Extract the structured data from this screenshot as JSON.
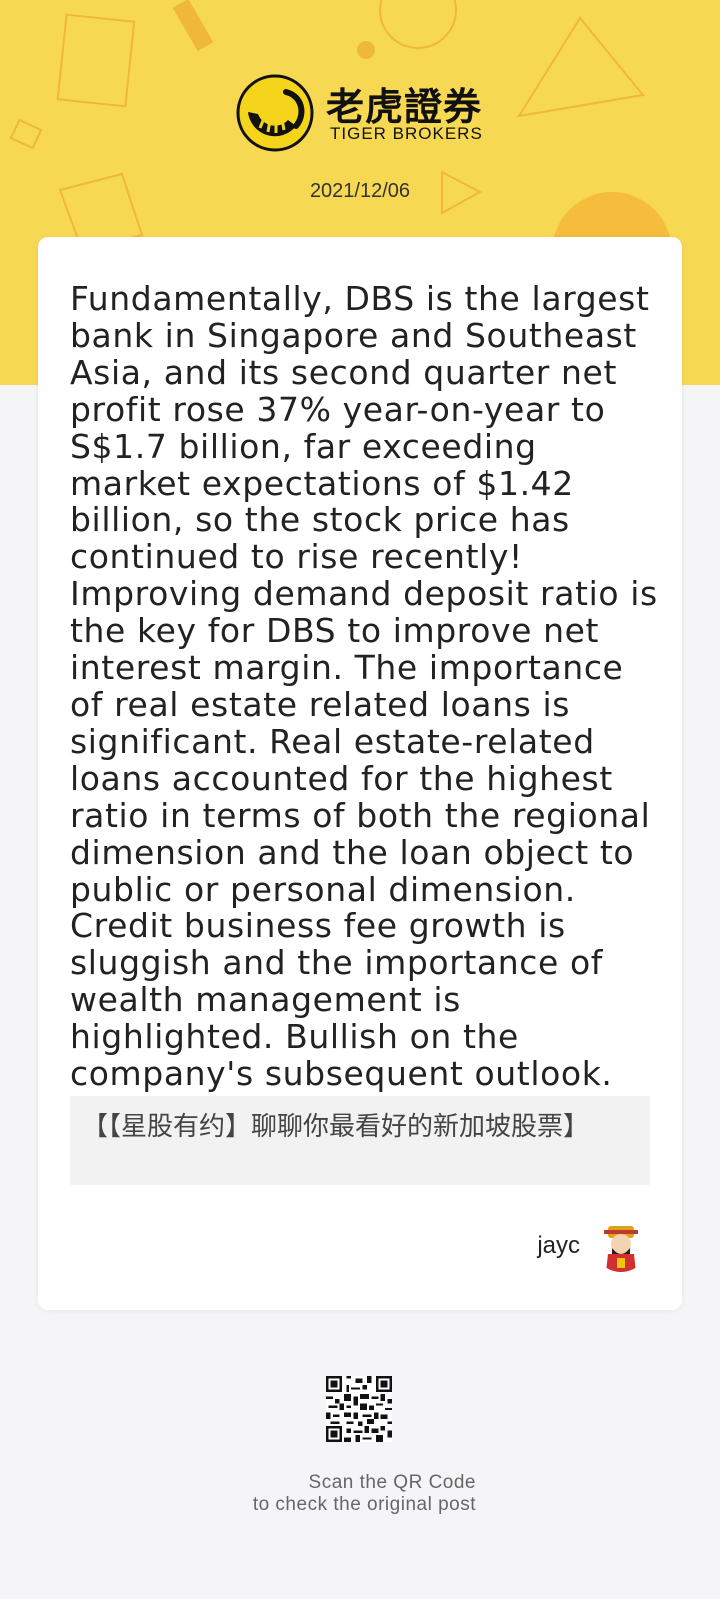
{
  "header": {
    "brand_cn": "老虎證券",
    "brand_en": "TIGER BROKERS",
    "date": "2021/12/06"
  },
  "post": {
    "body": "Fundamentally, DBS is the largest bank in Singapore and Southeast Asia, and its second quarter net profit rose 37% year-on-year to S$1.7 billion, far exceeding market expectations of $1.42 billion, so the stock price has continued to rise recently! Improving demand deposit ratio is the key for DBS to improve net interest margin. The importance of real estate related loans is significant. Real estate-related loans accounted for the highest ratio in terms of both the regional dimension and the loan object to public or personal dimension. Credit business fee growth is sluggish and the importance of wealth management is highlighted. Bullish on the company's subsequent outlook.",
    "topic": "【【星股有约】聊聊你最看好的新加坡股票】",
    "author": "jayc"
  },
  "footer": {
    "qr_line1": "Scan the QR Code",
    "qr_line2": "to check the original post"
  },
  "colors": {
    "brand_yellow": "#f7d853",
    "page_bg": "#f5f5f7",
    "card_bg": "#ffffff"
  },
  "icons": {
    "logo": "tiger-logo-icon",
    "avatar": "god-of-wealth-avatar",
    "qr": "qr-code-icon"
  }
}
